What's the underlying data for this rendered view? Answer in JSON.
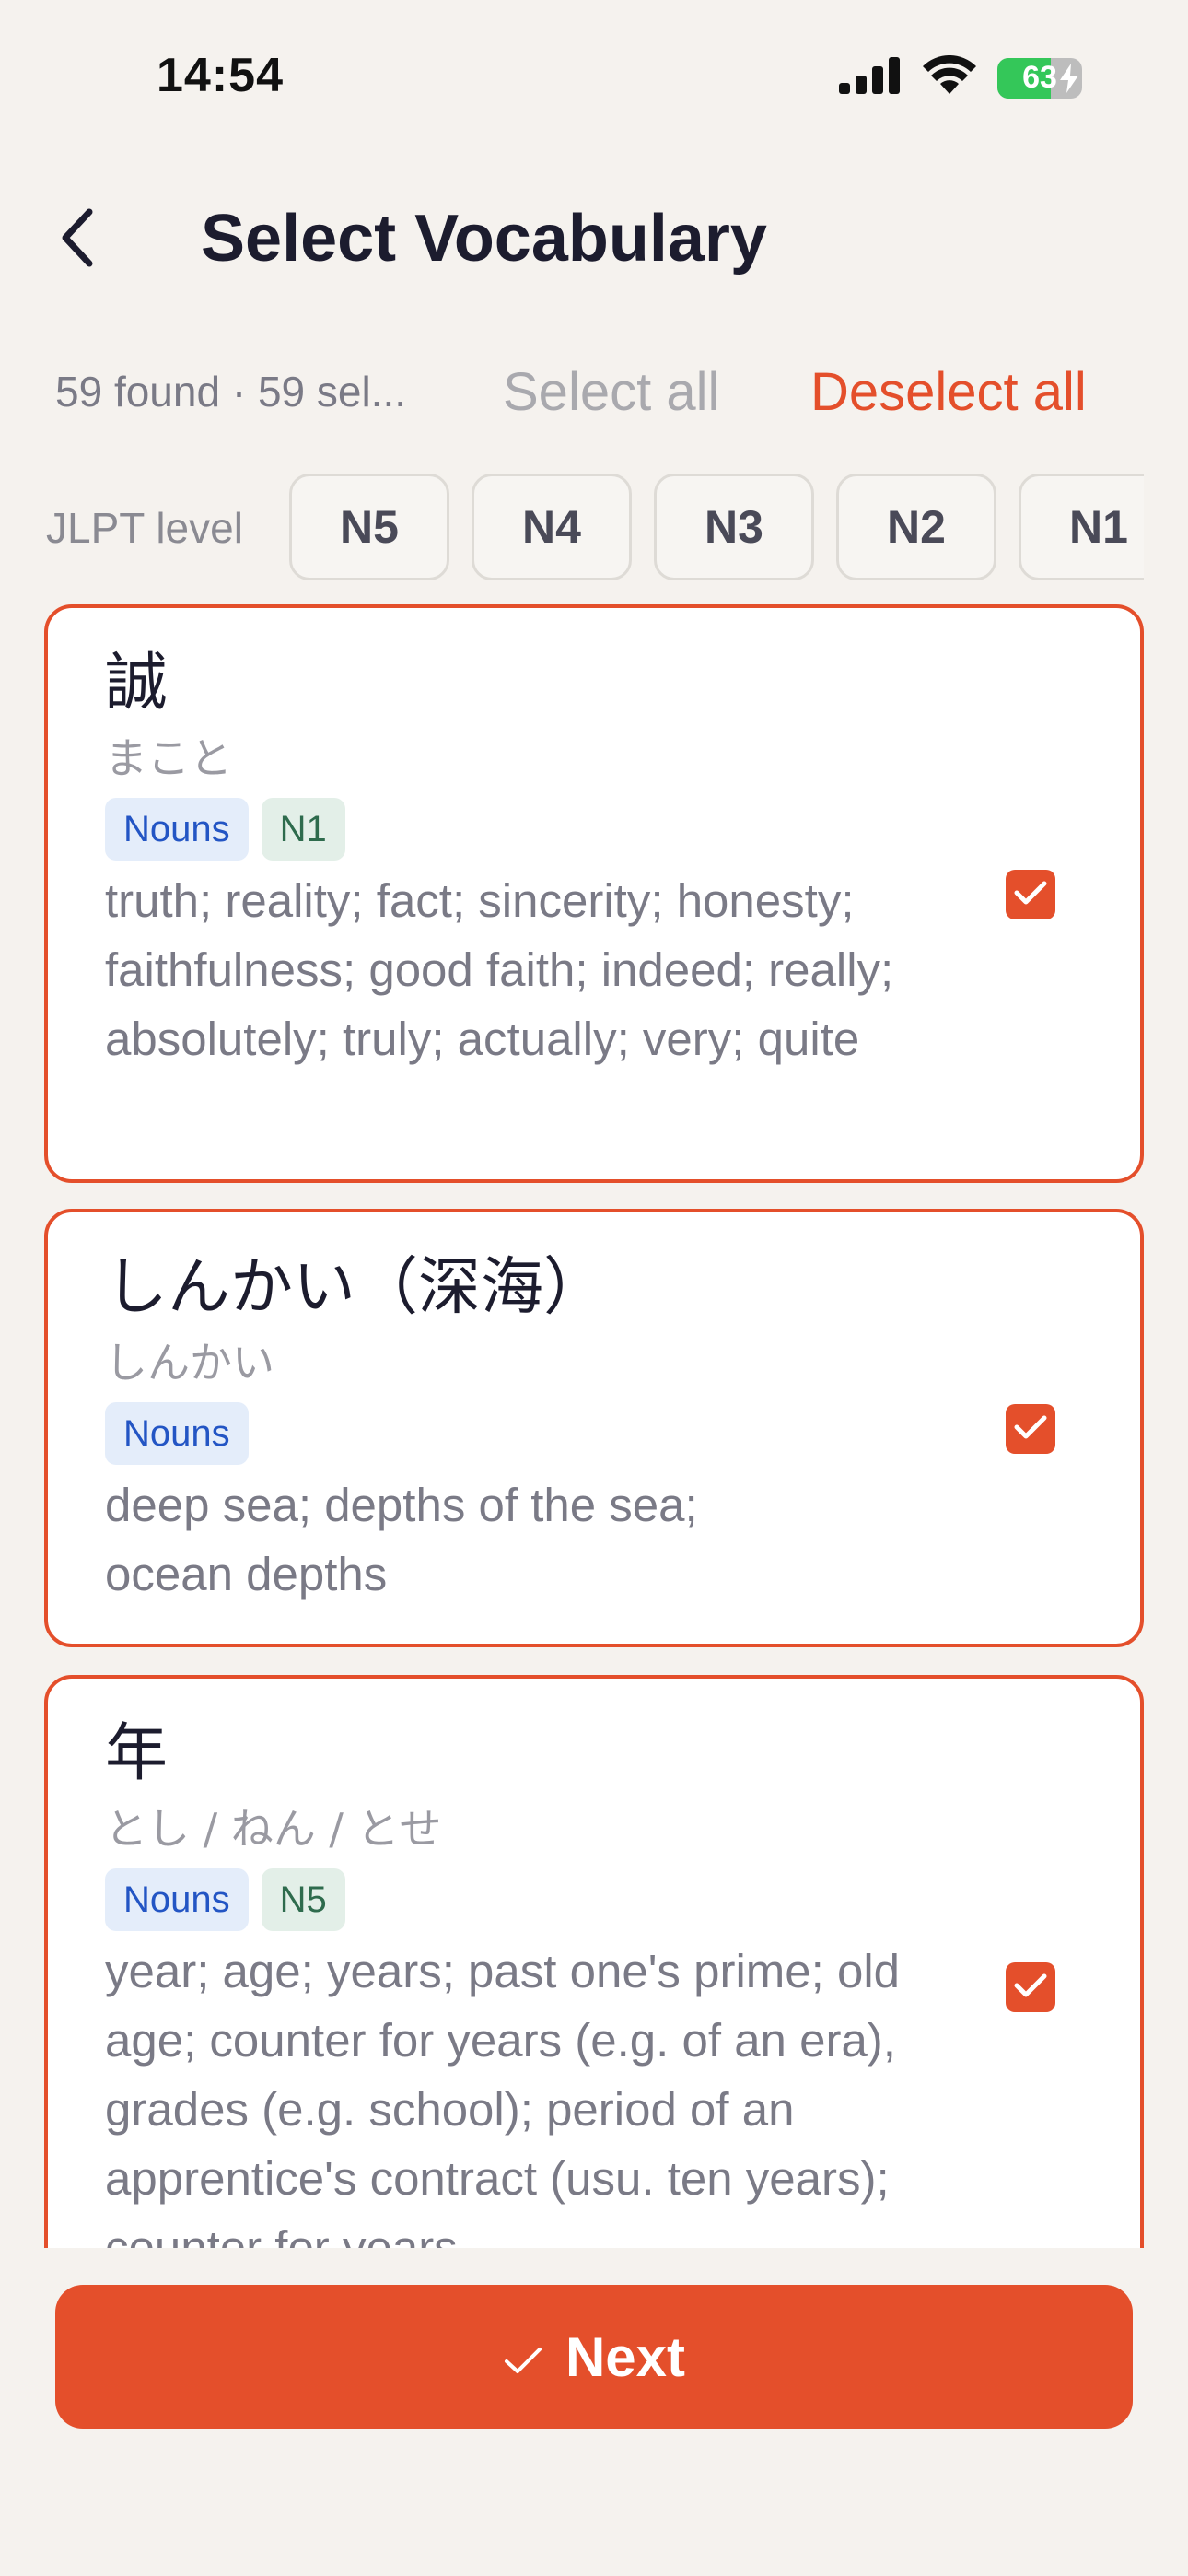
{
  "status_bar": {
    "time": "14:54",
    "battery_level": "63",
    "icons": [
      "signal-icon",
      "wifi-icon",
      "battery-icon",
      "charging-bolt-icon"
    ]
  },
  "header": {
    "title": "Select Vocabulary",
    "back_icon": "chevron-left-icon"
  },
  "selection": {
    "count_text": "59 found · 59 sel...",
    "select_all_label": "Select all",
    "deselect_all_label": "Deselect all"
  },
  "filter": {
    "label": "JLPT level",
    "levels": [
      "N5",
      "N4",
      "N3",
      "N2",
      "N1"
    ]
  },
  "vocabulary": [
    {
      "word": "誠",
      "reading": "まこと",
      "pos": "Nouns",
      "level": "N1",
      "meaning": "truth; reality; fact; sincerity; honesty; faithfulness; good faith; indeed; really; absolutely; truly; actually; very; quite",
      "selected": true
    },
    {
      "word": "しんかい（深海）",
      "reading": "しんかい",
      "pos": "Nouns",
      "level": "",
      "meaning": "deep sea; depths of the sea; ocean depths",
      "selected": true
    },
    {
      "word": "年",
      "reading": "とし / ねん / とせ",
      "pos": "Nouns",
      "level": "N5",
      "meaning": "year; age; years; past one's prime; old age; counter for years (e.g. of an era), grades (e.g. school); period of an apprentice's contract (usu. ten years); counter for years",
      "selected": true
    }
  ],
  "footer": {
    "next_label": "Next",
    "next_icon": "checkmark-icon"
  },
  "colors": {
    "accent": "#e44f2b",
    "background": "#f5f2ee",
    "tag_pos_bg": "#e4edfa",
    "tag_pos_text": "#2355c4",
    "tag_level_bg": "#e3efe8",
    "tag_level_text": "#2e6b4d"
  }
}
